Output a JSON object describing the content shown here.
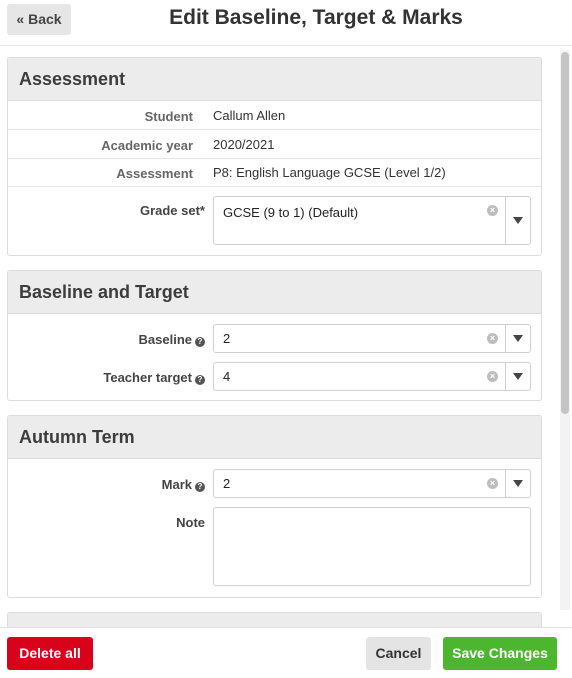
{
  "header": {
    "back_label": "« Back",
    "title": "Edit Baseline, Target & Marks"
  },
  "assessment": {
    "title": "Assessment",
    "rows": [
      {
        "label": "Student",
        "value": "Callum Allen"
      },
      {
        "label": "Academic year",
        "value": "2020/2021"
      },
      {
        "label": "Assessment",
        "value": "P8: English Language GCSE (Level 1/2)"
      }
    ],
    "grade_set_label": "Grade set*",
    "grade_set_value": "GCSE (9 to 1) (Default)"
  },
  "baseline_target": {
    "title": "Baseline and Target",
    "baseline_label": "Baseline",
    "baseline_value": "2",
    "teacher_target_label": "Teacher target",
    "teacher_target_value": "4"
  },
  "autumn_term": {
    "title": "Autumn Term",
    "mark_label": "Mark",
    "mark_value": "2",
    "note_label": "Note",
    "note_value": ""
  },
  "footer": {
    "delete_label": "Delete all",
    "cancel_label": "Cancel",
    "save_label": "Save Changes"
  },
  "icons": {
    "help": "help-icon",
    "clear": "clear-icon",
    "dropdown": "chevron-down-icon"
  },
  "colors": {
    "delete": "#d9021b",
    "save": "#4cb72e",
    "panel_header": "#ececec"
  }
}
